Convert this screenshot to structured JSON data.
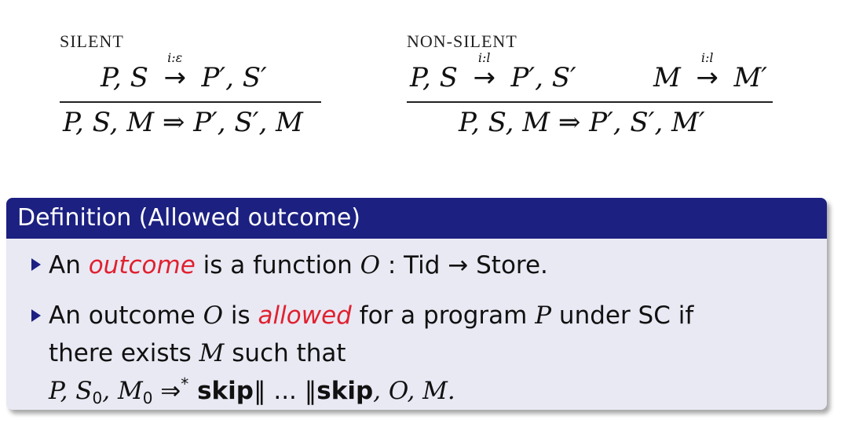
{
  "rules": {
    "silent": {
      "label": "SILENT",
      "premise": {
        "left": "P, S",
        "arrow_label": "i:ε",
        "right": "P′, S′"
      },
      "conclusion": "P, S, M ⇒ P′, S′, M"
    },
    "nonsilent": {
      "label": "NON-SILENT",
      "premise1": {
        "left": "P, S",
        "arrow_label": "i:l",
        "right": "P′, S′"
      },
      "premise2": {
        "left": "M",
        "arrow_label": "i:l",
        "right": "M′"
      },
      "conclusion": "P, S, M ⇒ P′, S′, M′"
    }
  },
  "definition": {
    "title": "Definition (Allowed outcome)",
    "item1": {
      "pre": "An ",
      "emph": "outcome",
      "post": " is a function ",
      "math_o": "O",
      "math_rest": " : Tid → Store."
    },
    "item2": {
      "pre": "An outcome ",
      "math_o": "O",
      "mid": " is ",
      "emph": "allowed",
      "post": " for a program ",
      "math_p": "P",
      "tail": " under SC if",
      "line2_pre": "there exists ",
      "math_m": "M",
      "line2_post": " such that",
      "line3_a": "P, S",
      "line3_sub0": "0",
      "line3_b": ", M",
      "line3_sub1": "0",
      "line3_c": " ⇒",
      "line3_star": "*",
      "line3_skip1": " skip",
      "line3_par": "‖ ... ‖",
      "line3_skip2": "skip",
      "line3_end": ", O, M."
    }
  }
}
